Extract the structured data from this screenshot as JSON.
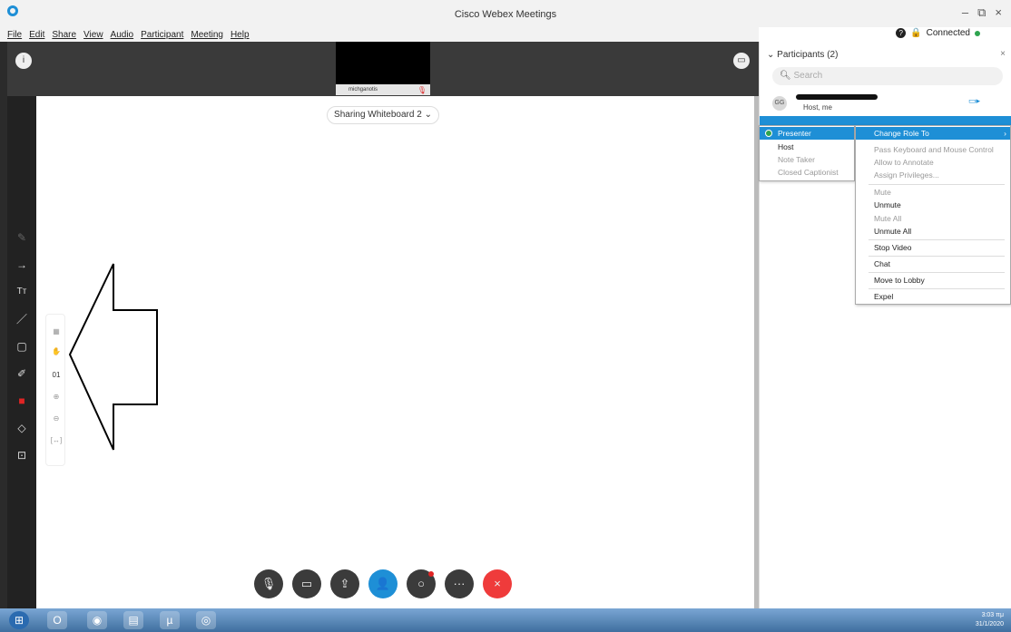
{
  "window": {
    "title": "Cisco Webex Meetings"
  },
  "menubar": [
    "File",
    "Edit",
    "Share",
    "View",
    "Audio",
    "Participant",
    "Meeting",
    "Help"
  ],
  "status": {
    "connection": "Connected"
  },
  "stage": {
    "camera_name": "michganotis",
    "sharing_label": "Sharing Whiteboard 2",
    "zoom_value": "01"
  },
  "participants": {
    "header": "Participants (2)",
    "search_placeholder": "Search",
    "host_row": {
      "initials": "GG",
      "role_label": "Host, me"
    }
  },
  "role_menu": {
    "items": [
      {
        "label": "Presenter",
        "checked": true
      },
      {
        "label": "Host"
      },
      {
        "label": "Note Taker",
        "disabled": true
      },
      {
        "label": "Closed Captionist",
        "disabled": true
      }
    ]
  },
  "context_menu": {
    "items": [
      {
        "label": "Change Role To",
        "highlight": true,
        "submenu": true
      },
      {
        "label": "Pass Keyboard and Mouse Control",
        "disabled": true
      },
      {
        "label": "Allow to Annotate",
        "disabled": true
      },
      {
        "label": "Assign Privileges...",
        "disabled": true
      },
      {
        "label": "Mute",
        "disabled": true
      },
      {
        "label": "Unmute"
      },
      {
        "label": "Mute All",
        "disabled": true
      },
      {
        "label": "Unmute All"
      },
      {
        "label": "Stop Video"
      },
      {
        "label": "Chat"
      },
      {
        "label": "Move to Lobby"
      },
      {
        "label": "Expel"
      }
    ]
  },
  "taskbar": {
    "time": "3:03 πμ",
    "date": "31/1/2020"
  }
}
